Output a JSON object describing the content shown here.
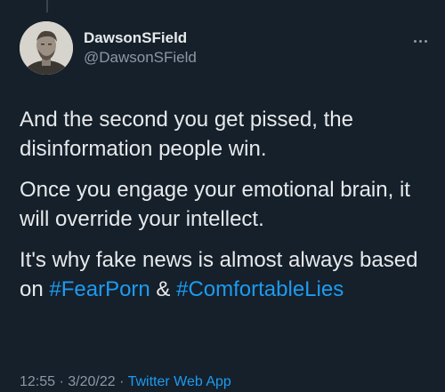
{
  "author": {
    "display_name": "DawsonSField",
    "handle": "@DawsonSField"
  },
  "tweet": {
    "paragraph1": "And the second you get pissed, the disinformation people win.",
    "paragraph2": "Once you engage your emotional brain, it will override your intellect.",
    "paragraph3_text": "It's why fake news is almost always based on ",
    "hashtag1": "#FearPorn",
    "connector": " & ",
    "hashtag2": "#ComfortableLies"
  },
  "meta": {
    "time": "12:55",
    "separator1": " · ",
    "date": "3/20/22",
    "separator2": " · ",
    "source": "Twitter Web App"
  },
  "colors": {
    "background": "#15202b",
    "text": "#e7e9ea",
    "secondary": "#8b98a5",
    "accent": "#1d9bf0"
  },
  "icons": {
    "more": "more-horizontal-icon"
  }
}
